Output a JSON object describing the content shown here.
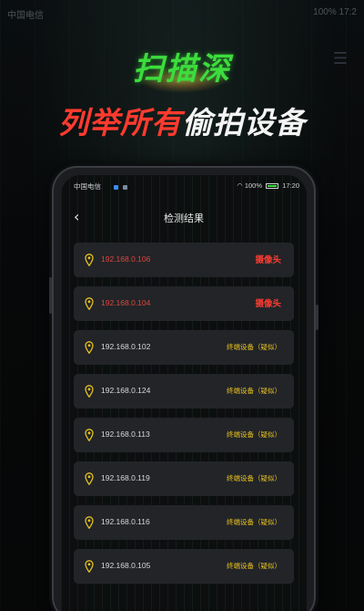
{
  "outer_status": {
    "left": "中国电信",
    "right": "100% 17:2"
  },
  "headline": {
    "line1": "扫描深",
    "line2_red": "列举所有",
    "line2_white": "偷拍设备"
  },
  "phone_status": {
    "carrier": "中国电信",
    "battery": "100%",
    "time": "17:20"
  },
  "nav": {
    "back_icon": "chevron-left-icon",
    "back": "‹",
    "title": "检测结果"
  },
  "devices": [
    {
      "ip": "192.168.0.106",
      "type": "摄像头",
      "kind": "camera"
    },
    {
      "ip": "192.168.0.104",
      "type": "摄像头",
      "kind": "camera"
    },
    {
      "ip": "192.168.0.102",
      "type": "终端设备（疑似）",
      "kind": "term"
    },
    {
      "ip": "192.168.0.124",
      "type": "终端设备（疑似）",
      "kind": "term"
    },
    {
      "ip": "192.168.0.113",
      "type": "终端设备（疑似）",
      "kind": "term"
    },
    {
      "ip": "192.168.0.119",
      "type": "终端设备（疑似）",
      "kind": "term"
    },
    {
      "ip": "192.168.0.116",
      "type": "终端设备（疑似）",
      "kind": "term"
    },
    {
      "ip": "192.168.0.105",
      "type": "终端设备（疑似）",
      "kind": "term"
    }
  ],
  "colors": {
    "camera": "#ff3b2f",
    "terminal": "#e8c21e",
    "pin": "#e8c21e",
    "accent_green": "#3ddc3d"
  }
}
